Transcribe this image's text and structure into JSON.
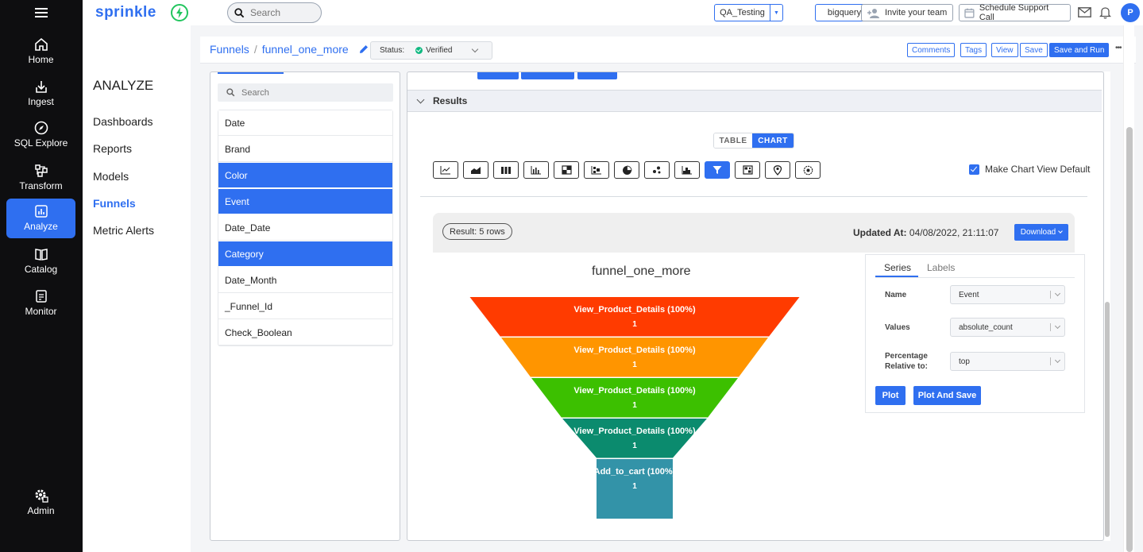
{
  "brand": {
    "name": "sprinkle",
    "color": "#2f6ff0"
  },
  "nav": {
    "items": [
      {
        "label": "Home",
        "icon": "home-icon"
      },
      {
        "label": "Ingest",
        "icon": "ingest-icon"
      },
      {
        "label": "SQL Explore",
        "icon": "compass-icon"
      },
      {
        "label": "Transform",
        "icon": "transform-icon"
      },
      {
        "label": "Analyze",
        "icon": "analyze-icon"
      },
      {
        "label": "Catalog",
        "icon": "book-icon"
      },
      {
        "label": "Monitor",
        "icon": "monitor-icon"
      },
      {
        "label": "Admin",
        "icon": "admin-gear-icon"
      }
    ]
  },
  "subnav": {
    "section": "ANALYZE",
    "items": [
      "Dashboards",
      "Reports",
      "Models",
      "Funnels",
      "Metric Alerts"
    ],
    "active": "Funnels"
  },
  "topbar": {
    "search_placeholder": "Search",
    "workspace": "QA_Testing",
    "warehouse": "bigquery",
    "invite_label": "Invite your team",
    "schedule_label": "Schedule Support Call",
    "avatar_initial": "P"
  },
  "breadcrumb": {
    "root": "Funnels",
    "separator": "/",
    "current": "funnel_one_more",
    "status_label": "Status:",
    "status_value": "Verified"
  },
  "toolbar": {
    "comments": "Comments",
    "tags": "Tags",
    "view": "View",
    "save": "Save",
    "save_and_run": "Save and Run",
    "more": "•••"
  },
  "fields": {
    "search_placeholder": "Search",
    "items": [
      {
        "label": "Date",
        "selected": false
      },
      {
        "label": "Brand",
        "selected": false
      },
      {
        "label": "Color",
        "selected": true
      },
      {
        "label": "Event",
        "selected": true
      },
      {
        "label": "Date_Date",
        "selected": false
      },
      {
        "label": "Category",
        "selected": true
      },
      {
        "label": "Date_Month",
        "selected": false
      },
      {
        "label": "_Funnel_Id",
        "selected": false
      },
      {
        "label": "Check_Boolean",
        "selected": false
      }
    ]
  },
  "results": {
    "header": "Results",
    "view_toggle": {
      "table": "TABLE",
      "chart": "CHART",
      "active": "CHART"
    },
    "make_default_label": "Make Chart View Default",
    "make_default_checked": true,
    "result_rows": "Result: 5 rows",
    "updated_label": "Updated At:",
    "updated_value": "04/08/2022, 21:11:07",
    "download_label": "Download"
  },
  "chart_types": [
    "line-chart-icon",
    "area-chart-icon",
    "column-chart-icon",
    "bar-chart-icon",
    "heatmap-icon",
    "grouped-chart-icon",
    "pie-chart-icon",
    "scatter-chart-icon",
    "histogram-icon",
    "funnel-icon",
    "pivot-icon",
    "map-pin-icon",
    "gauge-icon"
  ],
  "chart_types_active_index": 9,
  "series_panel": {
    "tabs": [
      "Series",
      "Labels"
    ],
    "active_tab": "Series",
    "name_label": "Name",
    "name_value": "Event",
    "values_label": "Values",
    "values_value": "absolute_count",
    "percentage_label_1": "Percentage",
    "percentage_label_2": "Relative to:",
    "percentage_value": "top",
    "plot_label": "Plot",
    "plot_save_label": "Plot And Save"
  },
  "chart_data": {
    "type": "funnel",
    "title": "funnel_one_more",
    "categories": [
      "View_Product_Details",
      "View_Product_Details",
      "View_Product_Details",
      "View_Product_Details",
      "Add_to_cart"
    ],
    "values": [
      1,
      1,
      1,
      1,
      1
    ],
    "percent_labels": [
      "View_Product_Details (100%)",
      "View_Product_Details (100%)",
      "View_Product_Details (100%)",
      "View_Product_Details (100%)",
      "Add_to_cart (100%)"
    ],
    "value_labels": [
      "1",
      "1",
      "1",
      "1",
      "1"
    ],
    "colors": [
      "#ff3b00",
      "#ff9500",
      "#3cc000",
      "#0b8b6e",
      "#3393a8"
    ]
  }
}
